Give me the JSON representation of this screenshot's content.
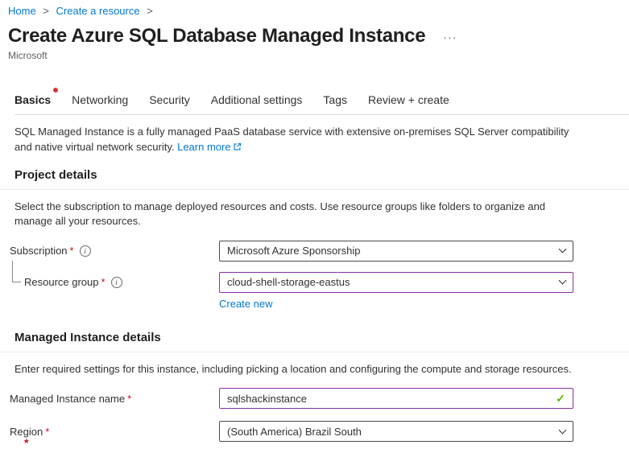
{
  "breadcrumb": {
    "separator": ">",
    "items": [
      {
        "label": "Home"
      },
      {
        "label": "Create a resource"
      }
    ]
  },
  "header": {
    "title": "Create Azure SQL Database Managed Instance",
    "more_label": "···",
    "publisher": "Microsoft"
  },
  "tabs": [
    {
      "label": "Basics",
      "active": true,
      "has_unsaved_indicator": true
    },
    {
      "label": "Networking",
      "active": false
    },
    {
      "label": "Security",
      "active": false
    },
    {
      "label": "Additional settings",
      "active": false
    },
    {
      "label": "Tags",
      "active": false
    },
    {
      "label": "Review + create",
      "active": false
    }
  ],
  "intro": {
    "text": "SQL Managed Instance is a fully managed PaaS database service with extensive on-premises SQL Server compatibility and native virtual network security.",
    "learn_more_label": "Learn more"
  },
  "common": {
    "required_marker": "*"
  },
  "project_details": {
    "heading": "Project details",
    "description": "Select the subscription to manage deployed resources and costs. Use resource groups like folders to organize and manage all your resources.",
    "subscription": {
      "label": "Subscription",
      "value": "Microsoft Azure Sponsorship"
    },
    "resource_group": {
      "label": "Resource group",
      "value": "cloud-shell-storage-eastus",
      "create_new_label": "Create new"
    }
  },
  "instance_details": {
    "heading": "Managed Instance details",
    "description": "Enter required settings for this instance, including picking a location and configuring the compute and storage resources.",
    "name": {
      "label": "Managed Instance name",
      "value": "sqlshackinstance",
      "valid": true
    },
    "region": {
      "label": "Region",
      "value": "(South America) Brazil South"
    }
  },
  "colors": {
    "link": "#0078d4",
    "required": "#c50f1f",
    "unsaved_dot": "#d13438",
    "dirty_field_border": "#8a2da5",
    "valid_check": "#5db300"
  }
}
